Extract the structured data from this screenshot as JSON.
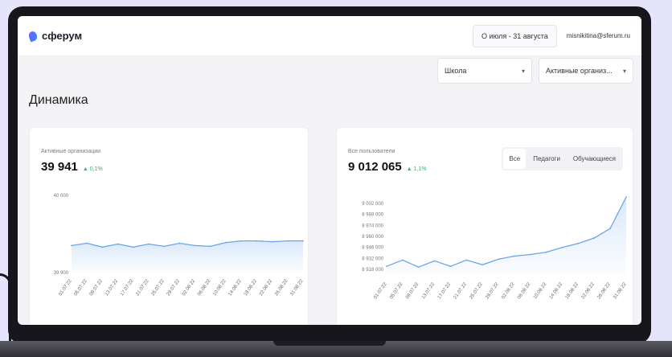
{
  "app": {
    "logo_text": "сферум"
  },
  "header": {
    "date_range": "О июля - 31 августа",
    "user_email": "misnikitina@sferum.ru"
  },
  "filters": {
    "school": "Школа",
    "org_status": "Активные организ..."
  },
  "page": {
    "title": "Динамика"
  },
  "card_orgs": {
    "label": "Активные организации",
    "value": "39 941",
    "delta": "▲ 0,1%"
  },
  "card_users": {
    "label": "Все пользователи",
    "value": "9 012 065",
    "delta": "▲ 1,1%",
    "tabs": [
      "Все",
      "Педагоги",
      "Обучающиеся"
    ],
    "active_tab": 0
  },
  "chart_data": [
    {
      "type": "area",
      "x": [
        "01.07.22",
        "05.07.22",
        "09.07.22",
        "13.07.22",
        "17.07.22",
        "21.07.22",
        "25.07.22",
        "29.07.22",
        "02.08.22",
        "06.08.22",
        "10.08.22",
        "14.08.22",
        "18.08.22",
        "22.08.22",
        "26.08.22",
        "31.08.22"
      ],
      "y": [
        39935,
        39938,
        39933,
        39937,
        39933,
        39937,
        39934,
        39938,
        39935,
        39934,
        39939,
        39941,
        39941,
        39940,
        39941,
        39941
      ],
      "y_tick_labels": [
        "40 000",
        "39 900"
      ],
      "ylim": [
        39900,
        40000
      ],
      "color": "#6aa5e8"
    },
    {
      "type": "area",
      "x": [
        "01.07.22",
        "05.07.22",
        "09.07.22",
        "13.07.22",
        "17.07.22",
        "21.07.22",
        "25.07.22",
        "29.07.22",
        "02.08.22",
        "06.08.22",
        "10.08.22",
        "14.08.22",
        "18.08.22",
        "22.08.22",
        "26.08.22",
        "31.08.22"
      ],
      "y": [
        8922000,
        8930000,
        8921000,
        8929000,
        8922000,
        8930000,
        8924000,
        8931000,
        8935000,
        8937000,
        8940000,
        8946000,
        8951000,
        8958000,
        8970000,
        9010000
      ],
      "y_tick_labels": [
        "9 002 000",
        "8 988 000",
        "8 974 000",
        "8 960 000",
        "8 946 000",
        "8 932 000",
        "8 918 000"
      ],
      "ylim": [
        8910000,
        9010000
      ],
      "color": "#6aa5e8"
    }
  ]
}
